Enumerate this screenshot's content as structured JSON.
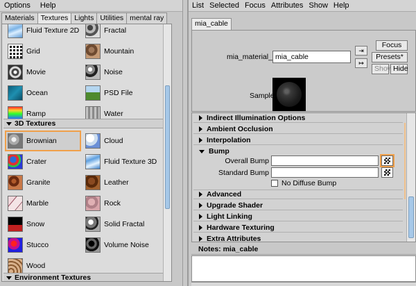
{
  "left": {
    "menu": [
      "Options",
      "Help"
    ],
    "tabs": [
      "Materials",
      "Textures",
      "Lights",
      "Utilities",
      "mental ray"
    ],
    "active_tab": "Textures",
    "items_2d": [
      {
        "label": "Fluid Texture 2D",
        "tex": "fluid2d"
      },
      {
        "label": "Fractal",
        "tex": "fractal"
      },
      {
        "label": "Grid",
        "tex": "grid"
      },
      {
        "label": "Mountain",
        "tex": "mountain"
      },
      {
        "label": "Movie",
        "tex": "movie"
      },
      {
        "label": "Noise",
        "tex": "noise"
      },
      {
        "label": "Ocean",
        "tex": "ocean"
      },
      {
        "label": "PSD File",
        "tex": "psd"
      },
      {
        "label": "Ramp",
        "tex": "ramp"
      },
      {
        "label": "Water",
        "tex": "water"
      }
    ],
    "section_3d": "3D Textures",
    "items_3d": [
      {
        "label": "Brownian",
        "tex": "brownian",
        "selected": true
      },
      {
        "label": "Cloud",
        "tex": "cloud"
      },
      {
        "label": "Crater",
        "tex": "crater"
      },
      {
        "label": "Fluid Texture 3D",
        "tex": "fluid3d"
      },
      {
        "label": "Granite",
        "tex": "granite"
      },
      {
        "label": "Leather",
        "tex": "leather"
      },
      {
        "label": "Marble",
        "tex": "marble"
      },
      {
        "label": "Rock",
        "tex": "rock"
      },
      {
        "label": "Snow",
        "tex": "snow"
      },
      {
        "label": "Solid Fractal",
        "tex": "solidfractal"
      },
      {
        "label": "Stucco",
        "tex": "stucco"
      },
      {
        "label": "Volume Noise",
        "tex": "volnoise"
      },
      {
        "label": "Wood",
        "tex": "wood"
      }
    ],
    "next_section_partial": "Environment Textures"
  },
  "right": {
    "menu": [
      "List",
      "Selected",
      "Focus",
      "Attributes",
      "Show",
      "Help"
    ],
    "tab": "mia_cable",
    "material_label": "mia_material_x:",
    "material_value": "mia_cable",
    "focus_btn": "Focus",
    "presets_btn": "Presets*",
    "show_btn": "Show",
    "hide_btn": "Hide",
    "sample_label": "Sample",
    "sections_top": [
      {
        "label": "Indirect Illumination Options",
        "open": false
      },
      {
        "label": "Ambient Occlusion",
        "open": false
      },
      {
        "label": "Interpolation",
        "open": false
      },
      {
        "label": "Bump",
        "open": true
      }
    ],
    "bump": {
      "overall_label": "Overall Bump",
      "standard_label": "Standard Bump",
      "no_diffuse_label": "No Diffuse Bump"
    },
    "sections_bottom": [
      {
        "label": "Advanced",
        "open": false
      },
      {
        "label": "Upgrade Shader",
        "open": false
      },
      {
        "label": "Light Linking",
        "open": false
      },
      {
        "label": "Hardware Texturing",
        "open": false
      },
      {
        "label": "Extra Attributes",
        "open": false
      }
    ],
    "notes_label": "Notes:  mia_cable"
  }
}
